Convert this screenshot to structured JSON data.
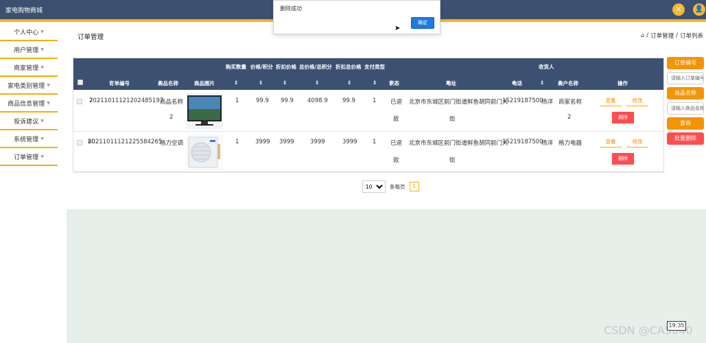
{
  "app": {
    "title": "家电购物商城"
  },
  "header_icons": {
    "left": "close-icon",
    "right": "user-icon"
  },
  "sidebar": {
    "items": [
      {
        "label": "个人中心"
      },
      {
        "label": "用户管理"
      },
      {
        "label": "商家管理"
      },
      {
        "label": "家电类别管理"
      },
      {
        "label": "商品信息管理"
      },
      {
        "label": "投诉建议"
      },
      {
        "label": "系统管理"
      },
      {
        "label": "订单管理"
      }
    ]
  },
  "page": {
    "title": "订单管理",
    "breadcrumb": [
      "订单管理",
      "订单列表"
    ],
    "breadcrumb_sep": "/"
  },
  "table": {
    "top_headers": [
      "购买数量",
      "价格/积分",
      "折扣价格",
      "总价格/总积分",
      "折扣总价格",
      "支付类型",
      "收货人"
    ],
    "headers": [
      "订单编号",
      "商品名称",
      "商品图片",
      "状态",
      "地址",
      "电话",
      "商户名称",
      "操作"
    ],
    "rows": [
      {
        "order_no": "20211011121202485197",
        "order_no_tail": "7",
        "product_name_1": "商品名称",
        "product_name_2": "2",
        "quantity": "1",
        "price": "99.9",
        "discount_price": "99.9",
        "total": "4098.9",
        "discount_total": "99.9",
        "pay_type": "1",
        "status_1": "已退",
        "status_2": "款",
        "address_1": "北京市东城区前门街道鲜鱼胡同前门大",
        "address_2": "街",
        "phone": "15219187500",
        "receiver": "杨洋",
        "merchant_1": "商家名称",
        "merchant_2": "2",
        "view": "查看",
        "edit": "修改",
        "delete": "删除"
      },
      {
        "order_no": "20211011121225584265",
        "order_no_tail": "80",
        "product_name_1": "格力空调",
        "product_name_2": "",
        "quantity": "1",
        "price": "3999",
        "discount_price": "3999",
        "total": "3999",
        "discount_total": "3999",
        "pay_type": "1",
        "status_1": "已退",
        "status_2": "款",
        "address_1": "北京市东城区前门街道鲜鱼胡同前门大",
        "address_2": "街",
        "phone": "15219187500",
        "receiver": "杨洋",
        "merchant_1": "格力电器",
        "merchant_2": "",
        "view": "查看",
        "edit": "修改",
        "delete": "删除"
      }
    ]
  },
  "pager": {
    "page_size": "10",
    "per_page_label": "条每页",
    "current_page": "1"
  },
  "search_panel": {
    "order_no_label": "订单编号",
    "order_no_placeholder": "请输入订单编号",
    "product_label": "商品名称",
    "product_placeholder": "请输入商品名称",
    "search_button": "查询",
    "batch_delete_button": "批量删除"
  },
  "dialog": {
    "message": "删除成功",
    "ok_label": "确定"
  },
  "watermark": "CSDN @CA5040",
  "clock": "19:35"
}
